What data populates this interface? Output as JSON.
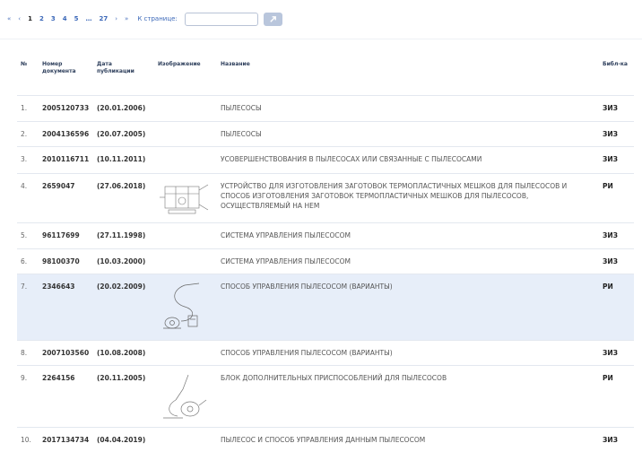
{
  "pagination": {
    "first": "«",
    "prev": "‹",
    "pages": [
      "1",
      "2",
      "3",
      "4",
      "5",
      "…",
      "27"
    ],
    "next": "›",
    "last": "»",
    "goto_label": "К странице:",
    "goto_value": ""
  },
  "table": {
    "headers": {
      "num": "№",
      "doc": "Номер документа",
      "date": "Дата публикации",
      "image": "Изображение",
      "title": "Название",
      "lib": "Библ-ка"
    },
    "rows": [
      {
        "num": "1.",
        "doc": "2005120733",
        "date": "(20.01.2006)",
        "title": "ПЫЛЕСОСЫ",
        "lib": "ЗИЗ",
        "image": "none"
      },
      {
        "num": "2.",
        "doc": "2004136596",
        "date": "(20.07.2005)",
        "title": "ПЫЛЕСОСЫ",
        "lib": "ЗИЗ",
        "image": "none"
      },
      {
        "num": "3.",
        "doc": "2010116711",
        "date": "(10.11.2011)",
        "title": "УСОВЕРШЕНСТВОВАНИЯ В ПЫЛЕСОСАХ ИЛИ СВЯЗАННЫЕ С ПЫЛЕСОСАМИ",
        "lib": "ЗИЗ",
        "image": "none"
      },
      {
        "num": "4.",
        "doc": "2659047",
        "date": "(27.06.2018)",
        "title": "УСТРОЙСТВО ДЛЯ ИЗГОТОВЛЕНИЯ ЗАГОТОВОК ТЕРМОПЛАСТИЧНЫХ МЕШКОВ ДЛЯ ПЫЛЕСОСОВ И СПОСОБ ИЗГОТОВЛЕНИЯ ЗАГОТОВОК ТЕРМОПЛАСТИЧНЫХ МЕШКОВ ДЛЯ ПЫЛЕСОСОВ, ОСУЩЕСТВЛЯЕМЫЙ НА НЕМ",
        "lib": "РИ",
        "image": "patent-drawing-machine"
      },
      {
        "num": "5.",
        "doc": "96117699",
        "date": "(27.11.1998)",
        "title": "СИСТЕМА УПРАВЛЕНИЯ ПЫЛЕСОСОМ",
        "lib": "ЗИЗ",
        "image": "none"
      },
      {
        "num": "6.",
        "doc": "98100370",
        "date": "(10.03.2000)",
        "title": "СИСТЕМА УПРАВЛЕНИЯ ПЫЛЕСОСОМ",
        "lib": "ЗИЗ",
        "image": "none"
      },
      {
        "num": "7.",
        "doc": "2346643",
        "date": "(20.02.2009)",
        "title": "СПОСОБ УПРАВЛЕНИЯ ПЫЛЕСОСОМ (ВАРИАНТЫ)",
        "lib": "РИ",
        "image": "patent-drawing-vacuum-hose",
        "highlight": true
      },
      {
        "num": "8.",
        "doc": "2007103560",
        "date": "(10.08.2008)",
        "title": "СПОСОБ УПРАВЛЕНИЯ ПЫЛЕСОСОМ (ВАРИАНТЫ)",
        "lib": "ЗИЗ",
        "image": "none"
      },
      {
        "num": "9.",
        "doc": "2264156",
        "date": "(20.11.2005)",
        "title": "БЛОК ДОПОЛНИТЕЛЬНЫХ ПРИСПОСОБЛЕНИЙ ДЛЯ ПЫЛЕСОСОВ",
        "lib": "РИ",
        "image": "patent-drawing-vacuum-attachment"
      },
      {
        "num": "10.",
        "doc": "2017134734",
        "date": "(04.04.2019)",
        "title": "ПЫЛЕСОС И СПОСОБ УПРАВЛЕНИЯ ДАННЫМ ПЫЛЕСОСОМ",
        "lib": "ЗИЗ",
        "image": "none"
      }
    ]
  }
}
